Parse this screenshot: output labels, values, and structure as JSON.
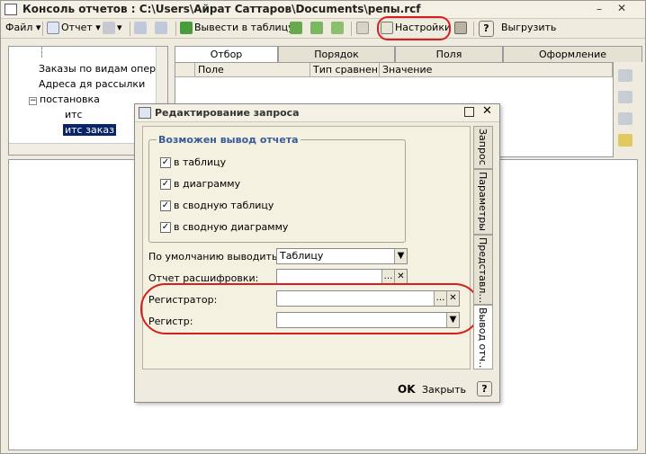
{
  "window": {
    "title": "Консоль отчетов : C:\\Users\\Айрат Саттаров\\Documents\\репы.rcf",
    "minimize": "–",
    "close": "✕"
  },
  "toolbar": {
    "file": "Файл ▾",
    "report": "Отчет ▾",
    "output_table": "Вывести в таблицу",
    "settings": "Настройки",
    "help": "?",
    "unload": "Выгрузить"
  },
  "tree": {
    "items": [
      "Заказы по видам опера",
      "Адреса дя рассылки",
      "постановка",
      "итс",
      "итс заказ"
    ]
  },
  "tabs": [
    "Отбор",
    "Порядок",
    "Поля",
    "Оформление"
  ],
  "grid": {
    "columns": [
      "Поле",
      "Тип сравнен…",
      "Значение"
    ]
  },
  "dialog": {
    "title": "Редактирование запроса",
    "group_label": "Возможен вывод отчета",
    "checkboxes": [
      {
        "label": "в таблицу",
        "checked": true
      },
      {
        "label": "в диаграмму",
        "checked": true
      },
      {
        "label": "в сводную таблицу",
        "checked": true
      },
      {
        "label": "в сводную диаграмму",
        "checked": true
      }
    ],
    "default_output_label": "По умолчанию выводить в:",
    "default_output_value": "Таблицу",
    "decode_report_label": "Отчет расшифровки:",
    "registrar_label": "Регистратор:",
    "register_label": "Регистр:",
    "vtabs": [
      "Запрос",
      "Параметры",
      "Представл…",
      "Вывод отч…"
    ],
    "ok": "OK",
    "close": "Закрыть",
    "help": "?"
  },
  "colors": {
    "highlight_red": "#d62020",
    "selection": "#0a246a",
    "group_label": "#3a5a9c"
  }
}
